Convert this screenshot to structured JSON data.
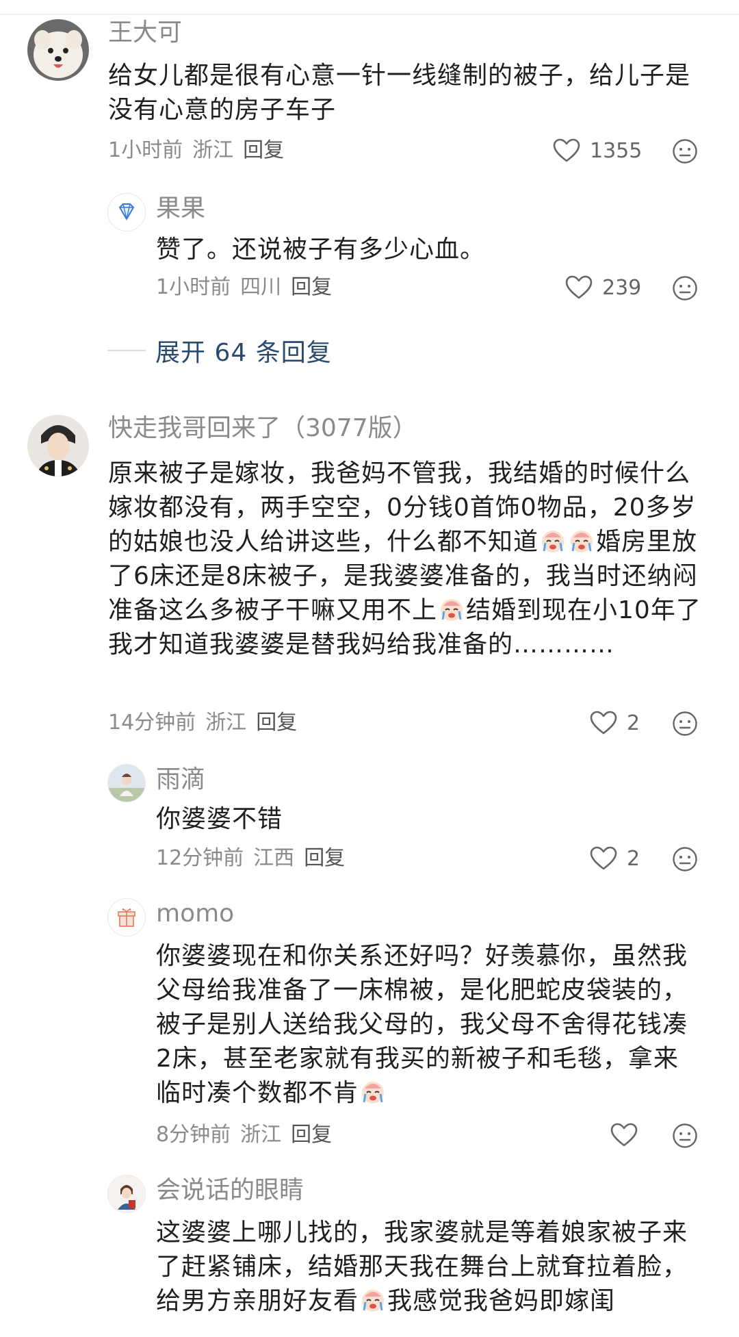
{
  "comments": [
    {
      "name": "王大可",
      "text": "给女儿都是很有心意一针一线缝制的被子，给儿子是没有心意的房子车子",
      "time": "1小时前",
      "location": "浙江",
      "reply": "回复",
      "likes": "1355"
    },
    {
      "name": "果果",
      "text": "赞了。还说被子有多少心血。",
      "time": "1小时前",
      "location": "四川",
      "reply": "回复",
      "likes": "239"
    },
    {
      "name": "快走我哥回来了（3077版）",
      "text_parts": [
        "原来被子是嫁妆，我爸妈不管我，我结婚的时候什么嫁妆都没有，两手空空，0分钱0首饰0物品，20多岁的姑娘也没人给讲这些，什么都不知道",
        "婚房里放了6床还是8床被子，是我婆婆准备的，我当时还纳闷准备这么多被子干嘛又用不上",
        "结婚到现在小10年了我才知道我婆婆是替我妈给我准备的…………"
      ],
      "time": "14分钟前",
      "location": "浙江",
      "reply": "回复",
      "likes": "2"
    },
    {
      "name": "雨滴",
      "text": "你婆婆不错",
      "time": "12分钟前",
      "location": "江西",
      "reply": "回复",
      "likes": "2"
    },
    {
      "name": "momo",
      "text": "你婆婆现在和你关系还好吗？好羡慕你，虽然我父母给我准备了一床棉被，是化肥蛇皮袋装的，被子是别人送给我父母的，我父母不舍得花钱凑2床，甚至老家就有我买的新被子和毛毯，拿来临时凑个数都不肯",
      "time": "8分钟前",
      "location": "浙江",
      "reply": "回复",
      "likes": ""
    },
    {
      "name": "会说话的眼睛",
      "text_parts": [
        "这婆婆上哪儿找的，我家婆就是等着娘家被子来了赶紧铺床，结婚那天我在舞台上就耷拉着脸，给男方亲朋好友看",
        "我感觉我爸妈即嫁闺"
      ]
    }
  ],
  "expand": {
    "label": "展开 64 条回复"
  },
  "icons": {
    "like": "heart-outline-icon",
    "face": "neutral-face-icon",
    "emoji": "crying-face-emoji"
  },
  "colors": {
    "name": "#8a8a8a",
    "expand": "#2a4a6d"
  }
}
